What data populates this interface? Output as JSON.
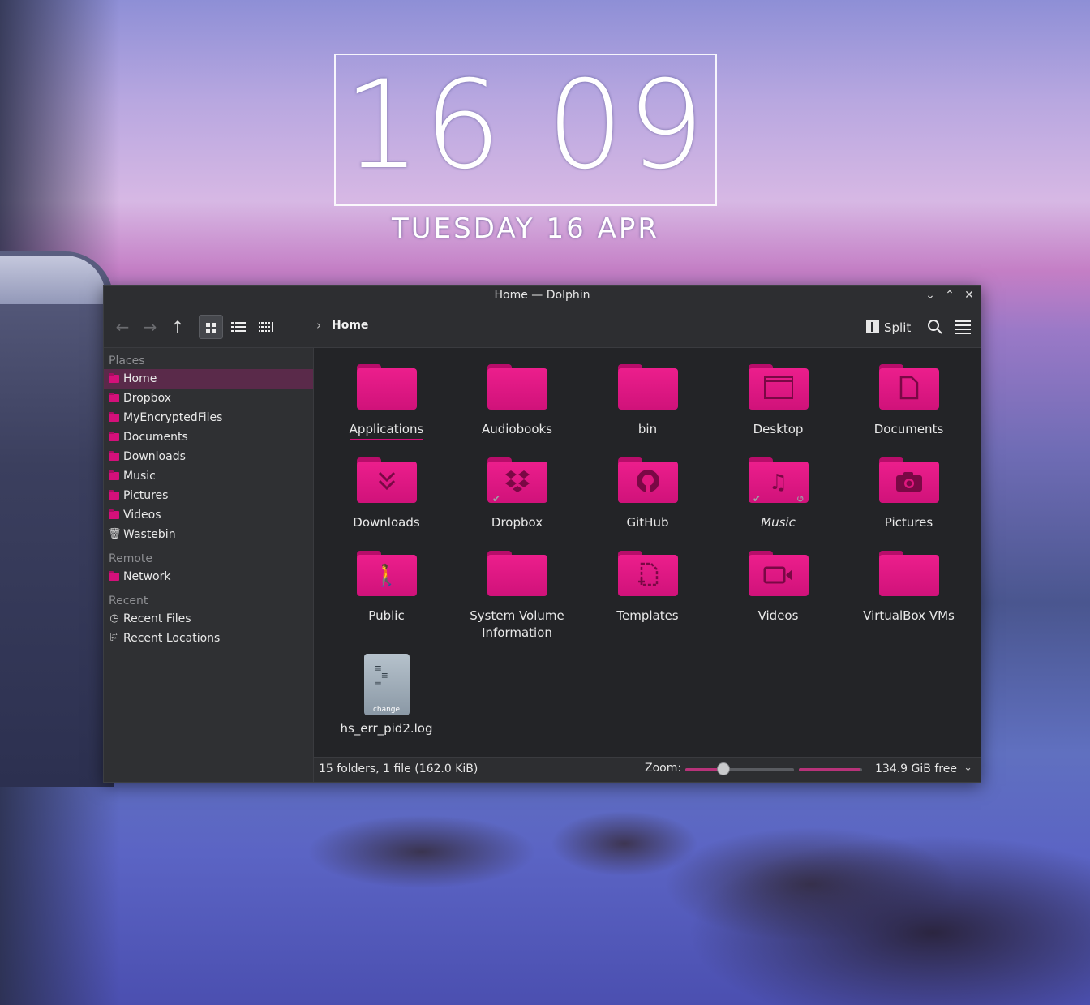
{
  "clock": {
    "time": "16 09",
    "date": "TUESDAY 16 APR"
  },
  "window": {
    "title": "Home — Dolphin",
    "controls": {
      "minimize": "⌄",
      "maximize": "⌃",
      "close": "✕"
    }
  },
  "toolbar": {
    "breadcrumb": "Home",
    "split_label": "Split",
    "icons": {
      "back": "arrow-left-icon",
      "forward": "arrow-right-icon",
      "up": "arrow-up-icon",
      "icons_view": "grid-view-icon",
      "details_view": "list-view-icon",
      "compact_view": "compact-view-icon",
      "search": "search-icon",
      "menu": "hamburger-menu-icon"
    }
  },
  "sidebar": {
    "places_header": "Places",
    "places": [
      "Home",
      "Dropbox",
      "MyEncryptedFiles",
      "Documents",
      "Downloads",
      "Music",
      "Pictures",
      "Videos",
      "Wastebin"
    ],
    "remote_header": "Remote",
    "remote": [
      "Network"
    ],
    "recent_header": "Recent",
    "recent": [
      "Recent Files",
      "Recent Locations"
    ]
  },
  "files": [
    {
      "name": "Applications",
      "icon": "folder"
    },
    {
      "name": "Audiobooks",
      "icon": "folder"
    },
    {
      "name": "bin",
      "icon": "folder"
    },
    {
      "name": "Desktop",
      "icon": "folder-desktop"
    },
    {
      "name": "Documents",
      "icon": "folder-documents"
    },
    {
      "name": "Downloads",
      "icon": "folder-downloads"
    },
    {
      "name": "Dropbox",
      "icon": "folder-dropbox"
    },
    {
      "name": "GitHub",
      "icon": "folder-github"
    },
    {
      "name": "Music",
      "icon": "folder-music"
    },
    {
      "name": "Pictures",
      "icon": "folder-pictures"
    },
    {
      "name": "Public",
      "icon": "folder-public"
    },
    {
      "name": "System Volume Information",
      "icon": "folder"
    },
    {
      "name": "Templates",
      "icon": "folder-templates"
    },
    {
      "name": "Videos",
      "icon": "folder-videos"
    },
    {
      "name": "VirtualBox VMs",
      "icon": "folder"
    },
    {
      "name": "hs_err_pid2.log",
      "icon": "text-log-file",
      "tag": "change"
    }
  ],
  "status": {
    "summary": "15 folders, 1 file (162.0 KiB)",
    "zoom_label": "Zoom:",
    "zoom_level": 0.35,
    "disk_used_fraction": 0.98,
    "free_space": "134.9 GiB free"
  },
  "colors": {
    "accent": "#d4107a",
    "window_bg": "#2a2b2e",
    "content_bg": "#232427"
  }
}
